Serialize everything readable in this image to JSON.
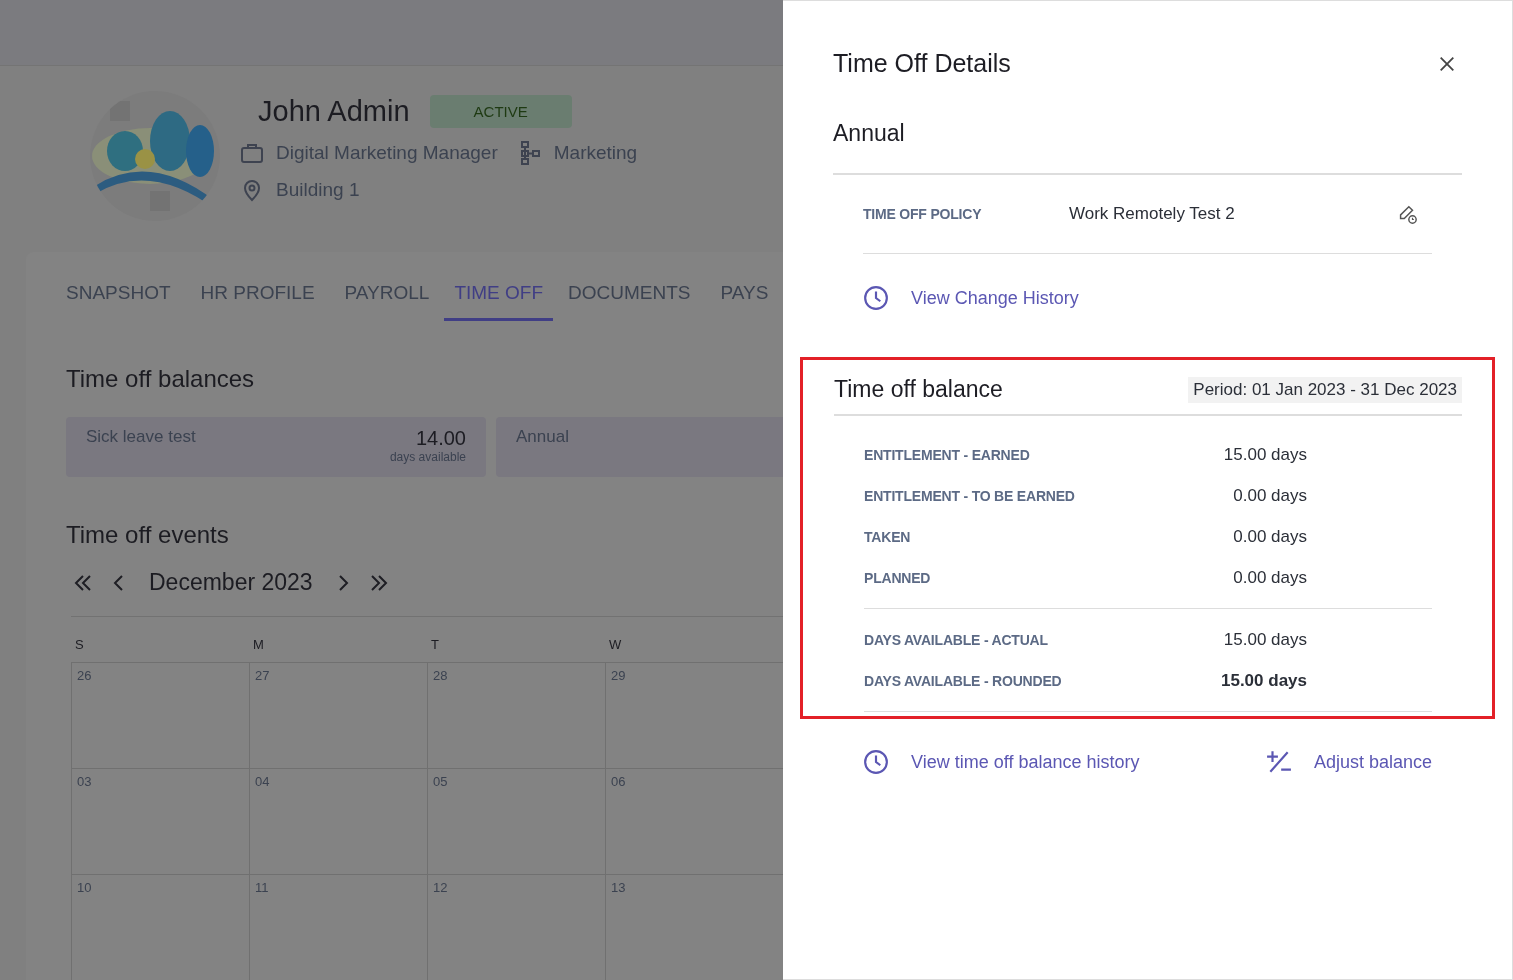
{
  "profile": {
    "name": "John Admin",
    "status": "ACTIVE",
    "job_title": "Digital Marketing Manager",
    "department": "Marketing",
    "location": "Building 1"
  },
  "tabs": [
    {
      "label": "SNAPSHOT",
      "selected": false
    },
    {
      "label": "HR PROFILE",
      "selected": false
    },
    {
      "label": "PAYROLL",
      "selected": false
    },
    {
      "label": "TIME OFF",
      "selected": true
    },
    {
      "label": "DOCUMENTS",
      "selected": false
    },
    {
      "label": "PAYS",
      "selected": false
    }
  ],
  "balances": {
    "title": "Time off balances",
    "cards": [
      {
        "name": "Sick leave test",
        "amount": "14.00",
        "unit": "days available"
      },
      {
        "name": "Annual"
      }
    ]
  },
  "events": {
    "title": "Time off events",
    "month": "December 2023",
    "weekdays": [
      "S",
      "M",
      "T",
      "W"
    ],
    "weeks": [
      [
        "26",
        "27",
        "28",
        "29"
      ],
      [
        "03",
        "04",
        "05",
        "06"
      ],
      [
        "10",
        "11",
        "12",
        "13"
      ]
    ]
  },
  "panel": {
    "title": "Time Off Details",
    "subtitle": "Annual",
    "policy_label": "TIME OFF POLICY",
    "policy_value": "Work Remotely Test 2",
    "change_history_link": "View Change History",
    "balance": {
      "title": "Time off balance",
      "period": "Period: 01 Jan 2023 - 31 Dec 2023",
      "highlighted": true,
      "rows": [
        {
          "label": "ENTITLEMENT - EARNED",
          "value": "15.00 days",
          "bold": false
        },
        {
          "label": "ENTITLEMENT - TO BE EARNED",
          "value": "0.00 days",
          "bold": false
        },
        {
          "label": "TAKEN",
          "value": "0.00 days",
          "bold": false
        },
        {
          "label": "PLANNED",
          "value": "0.00 days",
          "bold": false
        }
      ],
      "totals": [
        {
          "label": "DAYS AVAILABLE - ACTUAL",
          "value": "15.00 days",
          "bold": false
        },
        {
          "label": "DAYS AVAILABLE - ROUNDED",
          "value": "15.00 days",
          "bold": true
        }
      ]
    },
    "history_link": "View time off balance history",
    "adjust_link": "Adjust balance"
  }
}
